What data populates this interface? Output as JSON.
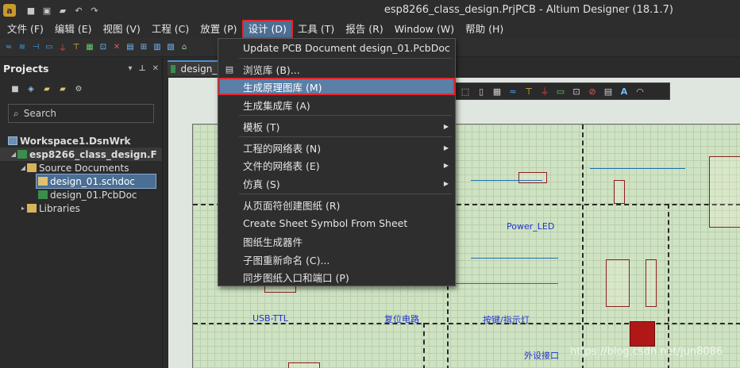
{
  "window": {
    "title": "esp8266_class_design.PrjPCB - Altium Designer (18.1.7)"
  },
  "menubar": {
    "items": [
      {
        "label": "文件 (F)"
      },
      {
        "label": "编辑 (E)"
      },
      {
        "label": "视图 (V)"
      },
      {
        "label": "工程 (C)"
      },
      {
        "label": "放置 (P)"
      },
      {
        "label": "设计 (D)"
      },
      {
        "label": "工具 (T)"
      },
      {
        "label": "报告 (R)"
      },
      {
        "label": "Window (W)"
      },
      {
        "label": "帮助 (H)"
      }
    ]
  },
  "design_menu": {
    "items": [
      {
        "label": "Update PCB Document design_01.PcbDoc",
        "submenu": false
      },
      {
        "label": "浏览库 (B)...",
        "submenu": false
      },
      {
        "label": "生成原理图库 (M)",
        "submenu": false
      },
      {
        "label": "生成集成库 (A)",
        "submenu": false
      },
      {
        "label": "模板 (T)",
        "submenu": true
      },
      {
        "label": "工程的网络表 (N)",
        "submenu": true
      },
      {
        "label": "文件的网络表 (E)",
        "submenu": true
      },
      {
        "label": "仿真 (S)",
        "submenu": true
      },
      {
        "label": "从页面符创建图纸 (R)",
        "submenu": false
      },
      {
        "label": "Create Sheet Symbol From Sheet",
        "submenu": false
      },
      {
        "label": "图纸生成器件",
        "submenu": false
      },
      {
        "label": "子图重新命名 (C)...",
        "submenu": false
      },
      {
        "label": "同步图纸入口和端口 (P)",
        "submenu": false
      }
    ]
  },
  "projects_panel": {
    "title": "Projects",
    "search_placeholder": "Search",
    "tree": {
      "workspace": "Workspace1.DsnWrk",
      "project": "esp8266_class_design.F",
      "folder_source": "Source Documents",
      "doc_sch": "design_01.schdoc",
      "doc_pcb": "design_01.PcbDoc",
      "folder_libs": "Libraries"
    }
  },
  "document_tab": {
    "label": "design_0"
  },
  "schematic": {
    "labels": {
      "power_led": "Power_LED",
      "usb_ttl": "USB-TTL",
      "reset": "复位电路",
      "button": "按键/指示灯",
      "peripheral": "外设接口"
    }
  },
  "watermark": "https://blog.csdn.net/jun8086"
}
